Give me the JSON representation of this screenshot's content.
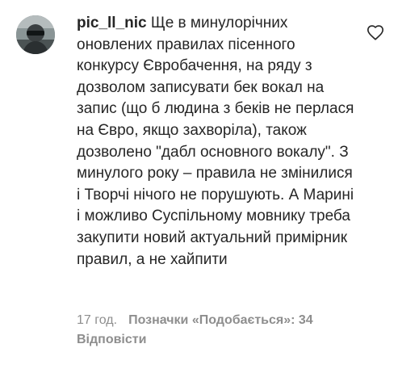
{
  "comment": {
    "username": "pic_ll_nic",
    "text": "Ще в минулорічних оновлених правилах пісенного конкурсу Євробачення, на ряду з дозволом записувати бек вокал на запис (що б людина з беків не перлася на Євро, якщо захворіла), також дозволено \"дабл основного вокалу\". З минулого року – правила не змінилися і Творчі нічого не порушують. А Марині і можливо Суспільному мовнику треба закупити новий актуальний примірник правил, а не хайпити",
    "time": "17 год.",
    "likes": "Позначки «Подобається»: 34",
    "reply": "Відповісти"
  },
  "icons": {
    "like": "heart-outline-icon",
    "avatar": "user-avatar"
  },
  "colors": {
    "text": "#262626",
    "secondary": "#8e8e8e",
    "background": "#ffffff"
  }
}
